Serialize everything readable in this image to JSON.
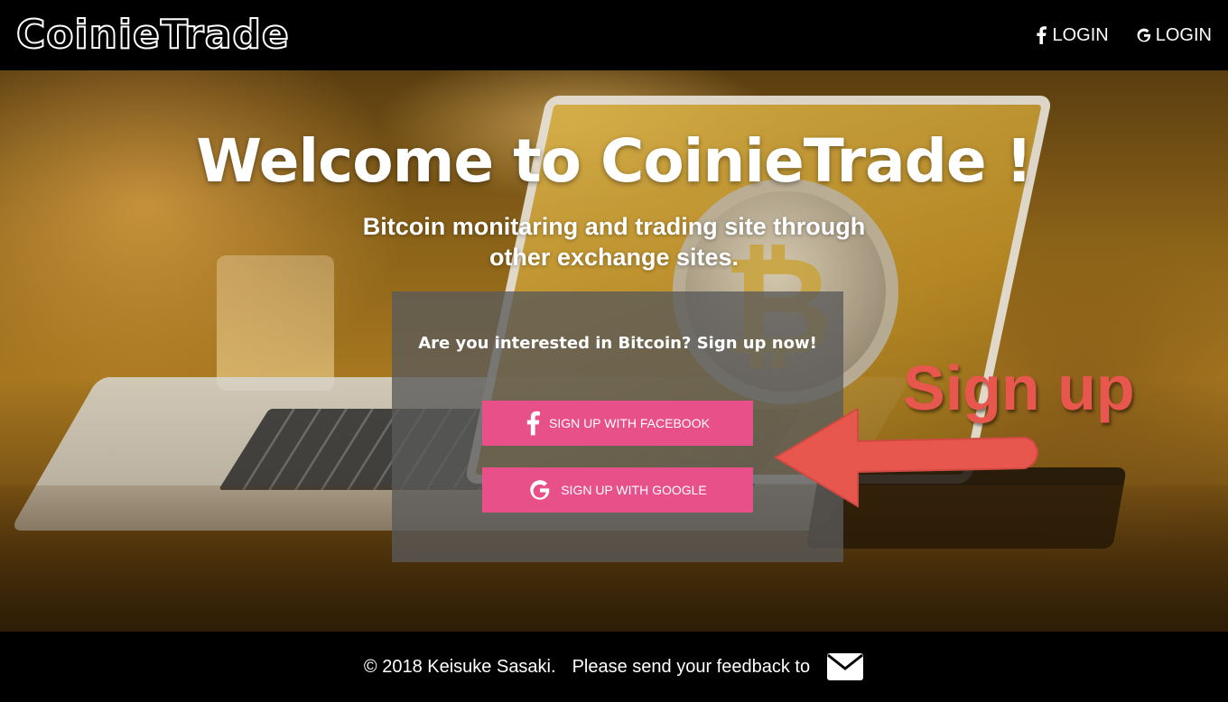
{
  "header": {
    "logo": "CoinieTrade",
    "facebook_login": "LOGIN",
    "google_login": "LOGIN"
  },
  "hero": {
    "title": "Welcome to CoinieTrade !",
    "subtitle": "Bitcoin monitaring and trading site through other exchange sites."
  },
  "signup": {
    "prompt": "Are you interested in Bitcoin? Sign up now!",
    "facebook_button": "SIGN UP WITH FACEBOOK",
    "google_button": "SIGN UP WITH GOOGLE"
  },
  "annotation": {
    "label": "Sign up"
  },
  "footer": {
    "copyright": "© 2018 Keisuke Sasaki.",
    "feedback": "Please send your feedback to"
  },
  "colors": {
    "button": "#e8508a",
    "annotation": "#e8574e"
  },
  "icons": [
    "facebook-icon",
    "google-icon",
    "mail-icon",
    "arrow-left-icon"
  ]
}
